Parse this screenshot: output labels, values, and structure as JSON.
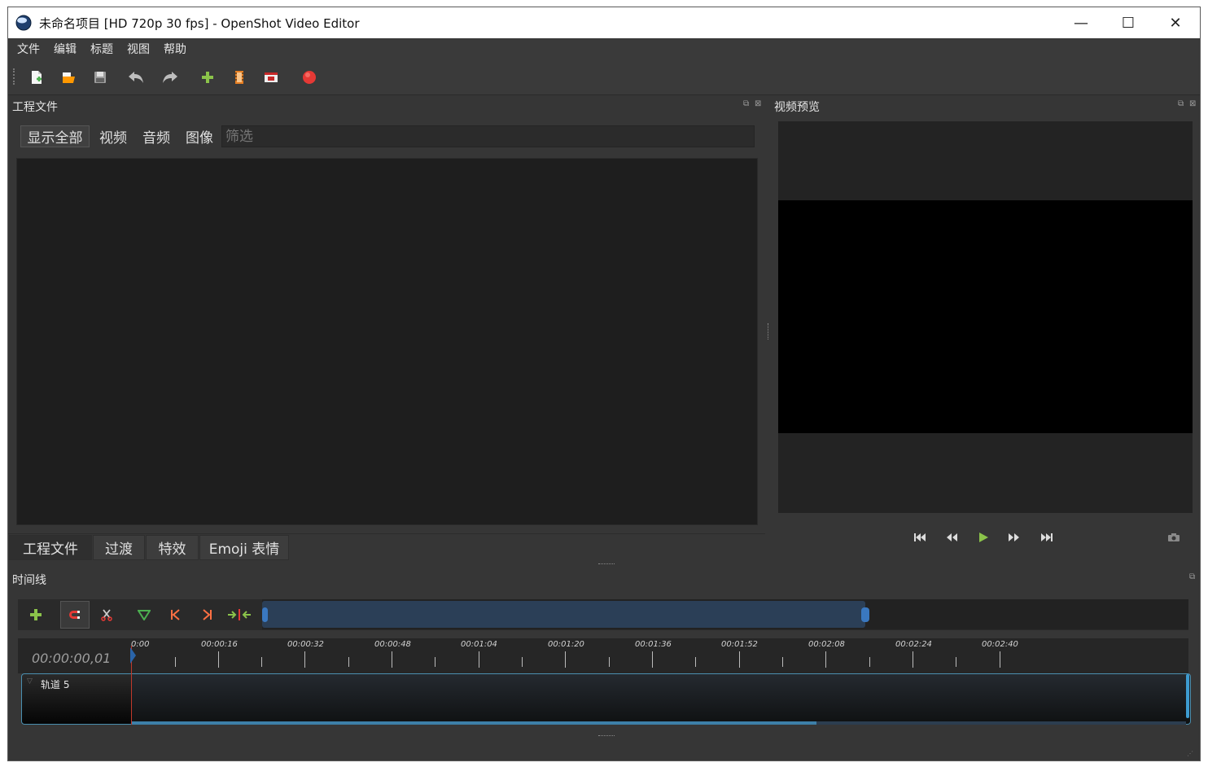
{
  "window": {
    "title": "未命名项目 [HD 720p 30 fps] - OpenShot Video Editor",
    "controls": {
      "minimize": "—",
      "maximize": "☐",
      "close": "✕"
    }
  },
  "menu": {
    "items": [
      "文件",
      "编辑",
      "标题",
      "视图",
      "帮助"
    ]
  },
  "toolbar": {
    "icons": [
      "new-project-icon",
      "open-project-icon",
      "save-project-icon",
      "undo-icon",
      "redo-icon",
      "import-files-icon",
      "profile-icon",
      "fullscreen-icon",
      "export-video-icon"
    ]
  },
  "project_files": {
    "title": "工程文件",
    "filters": [
      "显示全部",
      "视频",
      "音频",
      "图像"
    ],
    "filter_placeholder": "筛选",
    "tabs": [
      "工程文件",
      "过渡",
      "特效",
      "Emoji 表情"
    ]
  },
  "preview": {
    "title": "视频预览",
    "buttons": [
      "jump-start",
      "rewind",
      "play",
      "fast-forward",
      "jump-end"
    ]
  },
  "timeline": {
    "title": "时间线",
    "current_time": "00:00:00,01",
    "ruler_labels": [
      "0:00",
      "00:00:16",
      "00:00:32",
      "00:00:48",
      "00:01:04",
      "00:01:20",
      "00:01:36",
      "00:01:52",
      "00:02:08",
      "00:02:24",
      "00:02:40"
    ],
    "track": {
      "name": "轨道 5"
    }
  },
  "colors": {
    "background": "#363636",
    "panel_dark": "#1e1e1e",
    "accent_blue": "#3a78c0",
    "playhead_red": "#c0392b",
    "play_green": "#8bc34a",
    "record_red": "#e53935"
  }
}
